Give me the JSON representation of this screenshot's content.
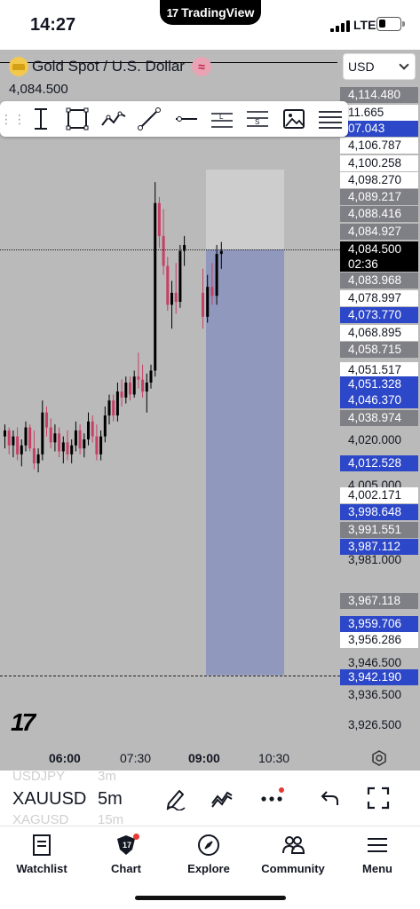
{
  "status_bar": {
    "time": "14:27",
    "network": "LTE",
    "battery_fraction": 0.3,
    "brand_pill": "TradingView"
  },
  "symbol": {
    "title": "Gold Spot / U.S. Dollar",
    "last_price": "4,084.500",
    "badge": "≈"
  },
  "currency_select": {
    "value": "USD"
  },
  "toolbar": {
    "tools": [
      {
        "name": "cursor-cross-icon"
      },
      {
        "name": "rectangle-tool-icon"
      },
      {
        "name": "path-tool-icon"
      },
      {
        "name": "trend-line-icon"
      },
      {
        "name": "horizontal-ray-icon"
      },
      {
        "name": "long-position-icon",
        "letter": "L"
      },
      {
        "name": "short-position-icon",
        "letter": "S"
      },
      {
        "name": "image-tool-icon"
      },
      {
        "name": "menu-lines-icon"
      }
    ]
  },
  "price_axis": {
    "labels": [
      {
        "text": "4,114.480",
        "style": "gray"
      },
      {
        "text": "11.665",
        "style": "white"
      },
      {
        "text": "07.043",
        "style": "blue"
      },
      {
        "text": "4,106.787",
        "style": "white"
      },
      {
        "text": "4,100.258",
        "style": "white"
      },
      {
        "text": "4,098.270",
        "style": "white"
      },
      {
        "text": "4,089.217",
        "style": "gray"
      },
      {
        "text": "4,088.416",
        "style": "gray"
      },
      {
        "text": "4,084.927",
        "style": "gray"
      },
      {
        "text": "4,083.968",
        "style": "gray"
      },
      {
        "text": "4,078.997",
        "style": "white"
      },
      {
        "text": "4,073.770",
        "style": "blue"
      },
      {
        "text": "4,068.895",
        "style": "white"
      },
      {
        "text": "4,058.715",
        "style": "gray"
      },
      {
        "text": "4,051.517",
        "style": "white"
      },
      {
        "text": "4,051.328",
        "style": "blue"
      },
      {
        "text": "4,046.370",
        "style": "blue"
      },
      {
        "text": "4,038.974",
        "style": "gray"
      },
      {
        "text": "4,020.000",
        "style": "plain"
      },
      {
        "text": "4,012.528",
        "style": "blue"
      },
      {
        "text": "4,005.000",
        "style": "plain"
      },
      {
        "text": "4,002.171",
        "style": "white"
      },
      {
        "text": "3,998.648",
        "style": "blue"
      },
      {
        "text": "3,991.551",
        "style": "gray"
      },
      {
        "text": "3,987.112",
        "style": "blue"
      },
      {
        "text": "3,981.000",
        "style": "plain"
      },
      {
        "text": "3,967.118",
        "style": "gray"
      },
      {
        "text": "3,959.706",
        "style": "blue"
      },
      {
        "text": "3,956.286",
        "style": "white"
      },
      {
        "text": "3,946.500",
        "style": "plain"
      },
      {
        "text": "3,942.190",
        "style": "blue"
      },
      {
        "text": "3,936.500",
        "style": "plain"
      },
      {
        "text": "3,926.500",
        "style": "plain"
      }
    ],
    "current_price": "4,084.500",
    "countdown": "02:36"
  },
  "time_axis": [
    {
      "text": "06:00",
      "bold": true
    },
    {
      "text": "07:30",
      "bold": false
    },
    {
      "text": "09:00",
      "bold": true
    },
    {
      "text": "10:30",
      "bold": false
    }
  ],
  "candles": [
    [
      4022,
      4026,
      4018,
      4024
    ],
    [
      4024,
      4025,
      4016,
      4019
    ],
    [
      4019,
      4024,
      4015,
      4022
    ],
    [
      4022,
      4025,
      4014,
      4016
    ],
    [
      4016,
      4021,
      4012,
      4019
    ],
    [
      4019,
      4027,
      4017,
      4025
    ],
    [
      4025,
      4026,
      4017,
      4018
    ],
    [
      4018,
      4024,
      4011,
      4013
    ],
    [
      4013,
      4018,
      4010,
      4016
    ],
    [
      4016,
      4034,
      4014,
      4030
    ],
    [
      4030,
      4032,
      4022,
      4025
    ],
    [
      4025,
      4028,
      4018,
      4020
    ],
    [
      4020,
      4026,
      4017,
      4023
    ],
    [
      4023,
      4025,
      4015,
      4017
    ],
    [
      4017,
      4022,
      4013,
      4020
    ],
    [
      4020,
      4024,
      4014,
      4016
    ],
    [
      4016,
      4021,
      4013,
      4019
    ],
    [
      4019,
      4027,
      4017,
      4024
    ],
    [
      4024,
      4026,
      4016,
      4018
    ],
    [
      4018,
      4023,
      4015,
      4021
    ],
    [
      4021,
      4030,
      4019,
      4027
    ],
    [
      4027,
      4029,
      4020,
      4022
    ],
    [
      4022,
      4026,
      4014,
      4016
    ],
    [
      4016,
      4024,
      4014,
      4022
    ],
    [
      4022,
      4032,
      4020,
      4029
    ],
    [
      4029,
      4036,
      4026,
      4034
    ],
    [
      4034,
      4036,
      4027,
      4029
    ],
    [
      4029,
      4040,
      4027,
      4037
    ],
    [
      4037,
      4041,
      4032,
      4035
    ],
    [
      4035,
      4042,
      4033,
      4040
    ],
    [
      4040,
      4042,
      4034,
      4036
    ],
    [
      4036,
      4044,
      4035,
      4042
    ],
    [
      4042,
      4050,
      4038,
      4041
    ],
    [
      4041,
      4046,
      4035,
      4037
    ],
    [
      4037,
      4043,
      4030,
      4040
    ],
    [
      4040,
      4046,
      4038,
      4044
    ],
    [
      4044,
      4107,
      4042,
      4100
    ],
    [
      4100,
      4102,
      4085,
      4089
    ],
    [
      4089,
      4098,
      4076,
      4079
    ],
    [
      4079,
      4082,
      4064,
      4066
    ],
    [
      4066,
      4074,
      4058,
      4070
    ],
    [
      4070,
      4080,
      4063,
      4067
    ],
    [
      4067,
      4086,
      4065,
      4084
    ],
    [
      4084,
      4089,
      4079,
      4086
    ]
  ],
  "position_tool": {
    "entry": 4084.5,
    "target": 4114.48,
    "stop": 3942.19
  },
  "bottom_bar": {
    "ghost_symbols": [
      {
        "symbol": "USDJPY",
        "tf": "3m"
      },
      {
        "symbol": "XAGUSD",
        "tf": "15m"
      }
    ],
    "symbol": "XAUUSD",
    "timeframe": "5m"
  },
  "tabs": [
    {
      "label": "Watchlist",
      "icon": "watchlist-icon"
    },
    {
      "label": "Chart",
      "icon": "chart-icon"
    },
    {
      "label": "Explore",
      "icon": "compass-icon"
    },
    {
      "label": "Community",
      "icon": "community-icon"
    },
    {
      "label": "Menu",
      "icon": "menu-icon"
    }
  ],
  "colors": {
    "up": "#000000",
    "down": "#c74065",
    "blue_label": "#2c47c8",
    "gray_label": "#7f7f86"
  }
}
